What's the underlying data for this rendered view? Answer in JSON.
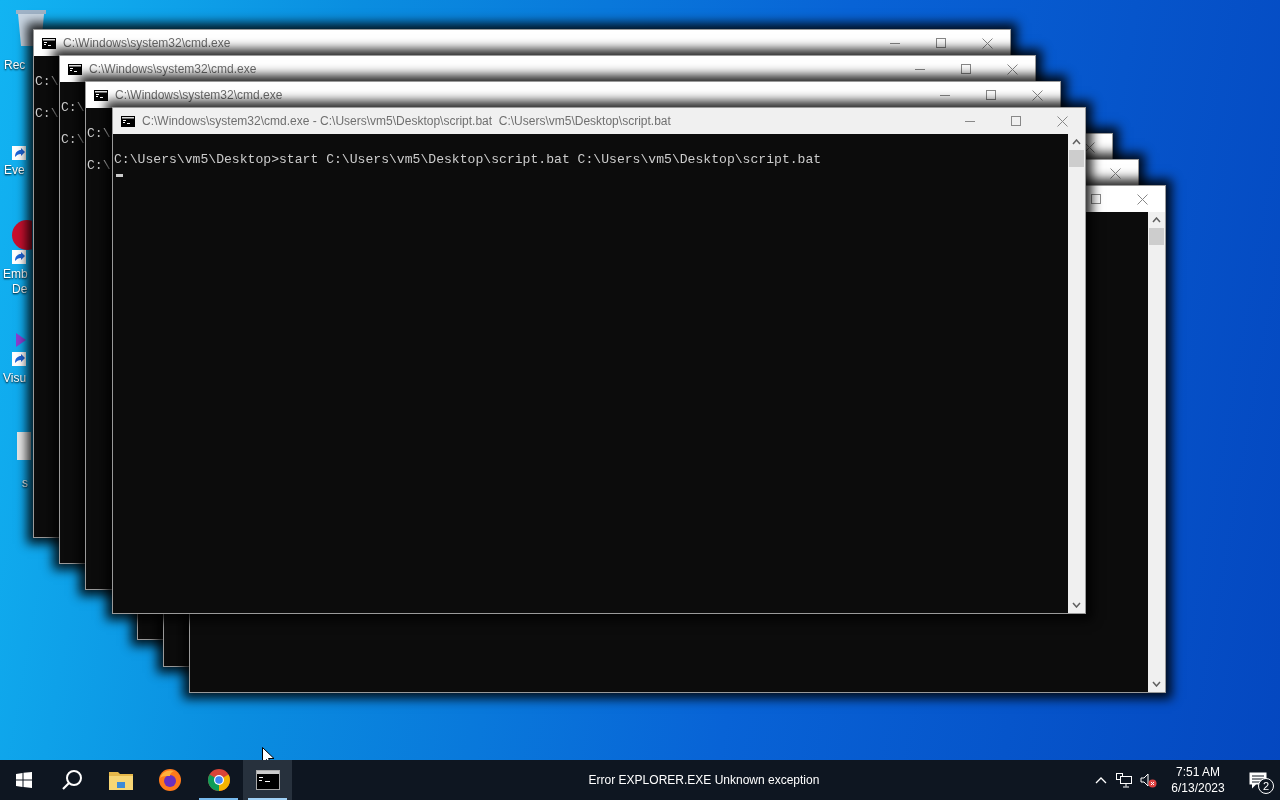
{
  "desktop_icons": [
    {
      "label": "Rec",
      "kind": "recycle"
    },
    {
      "label": "Eve",
      "kind": "shortcut"
    },
    {
      "label": "Emb",
      "kind": "red"
    },
    {
      "label": "De",
      "kind": "none"
    },
    {
      "label": "Visu",
      "kind": "purple"
    },
    {
      "label": "s",
      "kind": "grey"
    }
  ],
  "windows": [
    {
      "title": "C:\\Windows\\system32\\cmd.exe",
      "lines": [
        "C:\\",
        "C:\\"
      ],
      "buttons": [
        {
          "kind": "minimize"
        },
        {
          "kind": "maximize"
        },
        {
          "kind": "close"
        }
      ]
    },
    {
      "title": "C:\\Windows\\system32\\cmd.exe",
      "lines": [
        "C:\\",
        "C:\\"
      ],
      "buttons": [
        {
          "kind": "minimize"
        },
        {
          "kind": "maximize"
        },
        {
          "kind": "close"
        }
      ]
    },
    {
      "title": "C:\\Windows\\system32\\cmd.exe",
      "lines": [
        "C:\\",
        "C:\\"
      ],
      "buttons": [
        {
          "kind": "minimize"
        },
        {
          "kind": "maximize"
        },
        {
          "kind": "close"
        }
      ]
    },
    {
      "title": "C:\\Windows\\system32\\cmd.exe - C:\\Users\\vm5\\Desktop\\script.bat  C:\\Users\\vm5\\Desktop\\script.bat",
      "lines": [
        "C:\\Users\\vm5\\Desktop>start C:\\Users\\vm5\\Desktop\\script.bat C:\\Users\\vm5\\Desktop\\script.bat"
      ],
      "buttons": [
        {
          "kind": "minimize"
        },
        {
          "kind": "maximize"
        },
        {
          "kind": "close"
        }
      ],
      "scrollbar": true,
      "cursor": true
    },
    {
      "buttons": [
        {
          "kind": "close"
        }
      ]
    },
    {
      "buttons": [
        {
          "kind": "close"
        }
      ]
    },
    {
      "buttons": [
        {
          "kind": "maximize"
        },
        {
          "kind": "close"
        }
      ],
      "scrollbar": true
    }
  ],
  "taskbar": {
    "apps": [
      {
        "kind": "explorer",
        "running": false,
        "selected": false
      },
      {
        "kind": "firefox",
        "running": false,
        "selected": false
      },
      {
        "kind": "chrome",
        "running": true,
        "selected": false
      },
      {
        "kind": "terminal",
        "running": true,
        "selected": true
      }
    ],
    "message": "Error EXPLORER.EXE Unknown exception",
    "time": "7:51 AM",
    "date": "6/13/2023",
    "notifications": "2"
  }
}
